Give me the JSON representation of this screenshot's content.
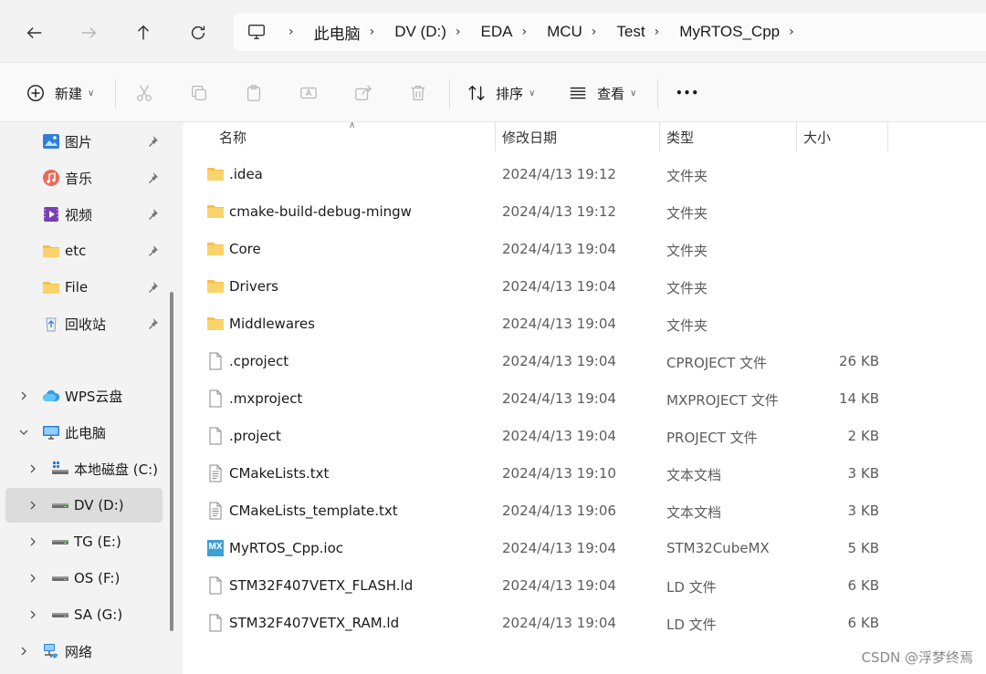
{
  "breadcrumbs": [
    "此电脑",
    "DV (D:)",
    "EDA",
    "MCU",
    "Test",
    "MyRTOS_Cpp"
  ],
  "toolbar": {
    "new_label": "新建",
    "sort_label": "排序",
    "view_label": "查看",
    "more_label": "•••"
  },
  "sidebar": {
    "quick_access": [
      {
        "label": "图片",
        "icon": "pictures-icon"
      },
      {
        "label": "音乐",
        "icon": "music-icon"
      },
      {
        "label": "视频",
        "icon": "videos-icon"
      },
      {
        "label": "etc",
        "icon": "folder-icon"
      },
      {
        "label": "File",
        "icon": "folder-icon"
      },
      {
        "label": "回收站",
        "icon": "recycle-bin-icon"
      }
    ],
    "wps": "WPS云盘",
    "this_pc": "此电脑",
    "drives": [
      "本地磁盘 (C:)",
      "DV (D:)",
      "TG (E:)",
      "OS (F:)",
      "SA (G:)"
    ],
    "network": "网络",
    "selected": "DV (D:)"
  },
  "columns": {
    "name": "名称",
    "date": "修改日期",
    "type": "类型",
    "size": "大小"
  },
  "files": [
    {
      "name": ".idea",
      "date": "2024/4/13 19:12",
      "type": "文件夹",
      "size": "",
      "icon": "folder"
    },
    {
      "name": "cmake-build-debug-mingw",
      "date": "2024/4/13 19:12",
      "type": "文件夹",
      "size": "",
      "icon": "folder"
    },
    {
      "name": "Core",
      "date": "2024/4/13 19:04",
      "type": "文件夹",
      "size": "",
      "icon": "folder"
    },
    {
      "name": "Drivers",
      "date": "2024/4/13 19:04",
      "type": "文件夹",
      "size": "",
      "icon": "folder"
    },
    {
      "name": "Middlewares",
      "date": "2024/4/13 19:04",
      "type": "文件夹",
      "size": "",
      "icon": "folder"
    },
    {
      "name": ".cproject",
      "date": "2024/4/13 19:04",
      "type": "CPROJECT 文件",
      "size": "26 KB",
      "icon": "file"
    },
    {
      "name": ".mxproject",
      "date": "2024/4/13 19:04",
      "type": "MXPROJECT 文件",
      "size": "14 KB",
      "icon": "file"
    },
    {
      "name": ".project",
      "date": "2024/4/13 19:04",
      "type": "PROJECT 文件",
      "size": "2 KB",
      "icon": "file"
    },
    {
      "name": "CMakeLists.txt",
      "date": "2024/4/13 19:10",
      "type": "文本文档",
      "size": "3 KB",
      "icon": "text"
    },
    {
      "name": "CMakeLists_template.txt",
      "date": "2024/4/13 19:06",
      "type": "文本文档",
      "size": "3 KB",
      "icon": "text"
    },
    {
      "name": "MyRTOS_Cpp.ioc",
      "date": "2024/4/13 19:04",
      "type": "STM32CubeMX",
      "size": "5 KB",
      "icon": "mx",
      "icon_text": "MX"
    },
    {
      "name": "STM32F407VETX_FLASH.ld",
      "date": "2024/4/13 19:04",
      "type": "LD 文件",
      "size": "6 KB",
      "icon": "file"
    },
    {
      "name": "STM32F407VETX_RAM.ld",
      "date": "2024/4/13 19:04",
      "type": "LD 文件",
      "size": "6 KB",
      "icon": "file"
    }
  ],
  "watermark": "CSDN @浮梦终焉",
  "colors": {
    "folder": "#f5c04a",
    "selected": "#dcdcdc",
    "mx_badge": "#3f9fd6"
  }
}
